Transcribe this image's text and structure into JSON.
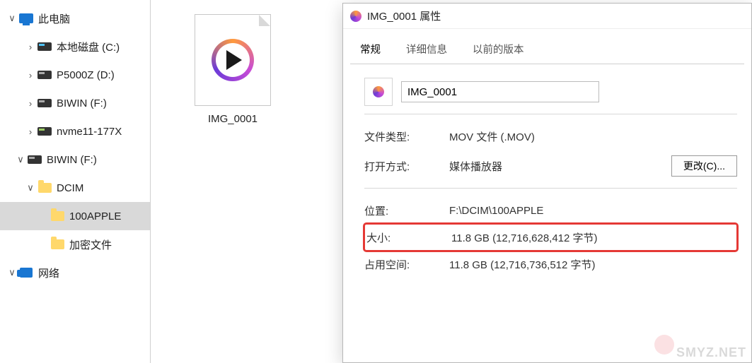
{
  "sidebar": {
    "this_pc": "此电脑",
    "drives": [
      {
        "label": "本地磁盘 (C:)"
      },
      {
        "label": "P5000Z (D:)"
      },
      {
        "label": "BIWIN (F:)"
      },
      {
        "label": "nvme11-177X"
      }
    ],
    "biwin": "BIWIN (F:)",
    "dcim": "DCIM",
    "apple_folder": "100APPLE",
    "enc_folder": "加密文件",
    "network": "网络"
  },
  "file": {
    "name": "IMG_0001"
  },
  "dialog": {
    "title": "IMG_0001 属性",
    "tabs": {
      "general": "常规",
      "details": "详细信息",
      "previous": "以前的版本"
    },
    "filename_value": "IMG_0001",
    "rows": {
      "type_k": "文件类型:",
      "type_v": "MOV 文件 (.MOV)",
      "open_k": "打开方式:",
      "open_v": "媒体播放器",
      "change_btn": "更改(C)...",
      "loc_k": "位置:",
      "loc_v": "F:\\DCIM\\100APPLE",
      "size_k": "大小:",
      "size_v": "11.8 GB (12,716,628,412 字节)",
      "ondisk_k": "占用空间:",
      "ondisk_v": "11.8 GB (12,716,736,512 字节)"
    }
  },
  "watermark": "SMYZ.NET"
}
